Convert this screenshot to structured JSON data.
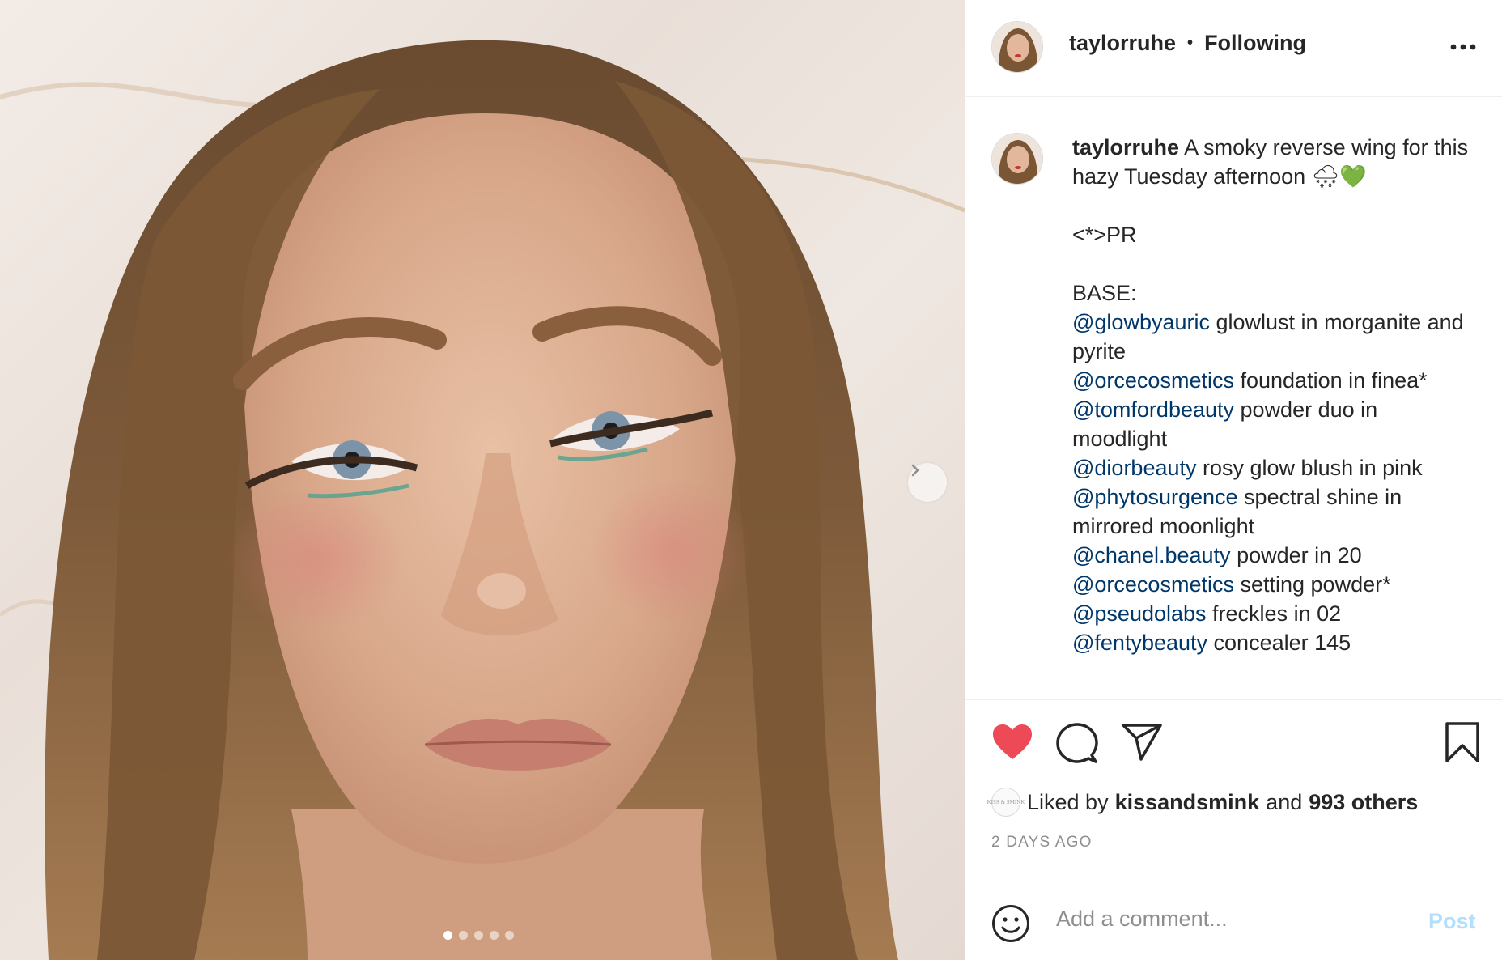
{
  "post": {
    "username": "taylorruhe",
    "separator": "•",
    "follow_status": "Following",
    "more_icon": "more-options-icon",
    "caption": {
      "username": "taylorruhe",
      "intro": "A smoky reverse wing for this hazy Tuesday afternoon 🌨💚",
      "disclosure": "<*>PR",
      "section_title": "BASE:",
      "products": [
        {
          "mention": "@glowbyauric",
          "text": "glowlust in morganite and pyrite"
        },
        {
          "mention": "@orcecosmetics",
          "text": "foundation in finea*"
        },
        {
          "mention": "@tomfordbeauty",
          "text": "powder duo in moodlight"
        },
        {
          "mention": "@diorbeauty",
          "text": "rosy glow blush in pink"
        },
        {
          "mention": "@phytosurgence",
          "text": "spectral shine in mirrored moonlight"
        },
        {
          "mention": "@chanel.beauty",
          "text": "powder in 20"
        },
        {
          "mention": "@orcecosmetics",
          "text": "setting powder*"
        },
        {
          "mention": "@pseudolabs",
          "text": "freckles in 02"
        },
        {
          "mention": "@fentybeauty",
          "text": "concealer 145"
        }
      ]
    },
    "likes": {
      "prefix": "Liked by",
      "liker": "kissandsmink",
      "joiner": "and",
      "others": "993 others",
      "liker_avatar_text": "KISS & SMINK"
    },
    "timestamp": "2 DAYS AGO",
    "comment": {
      "placeholder": "Add a comment...",
      "post_label": "Post"
    },
    "carousel": {
      "count": 5,
      "active_index": 0
    },
    "colors": {
      "like_red": "#ed4956",
      "mention_blue": "#00376b",
      "post_disabled": "#b2dffc",
      "muted_gray": "#8e8e8e"
    }
  }
}
